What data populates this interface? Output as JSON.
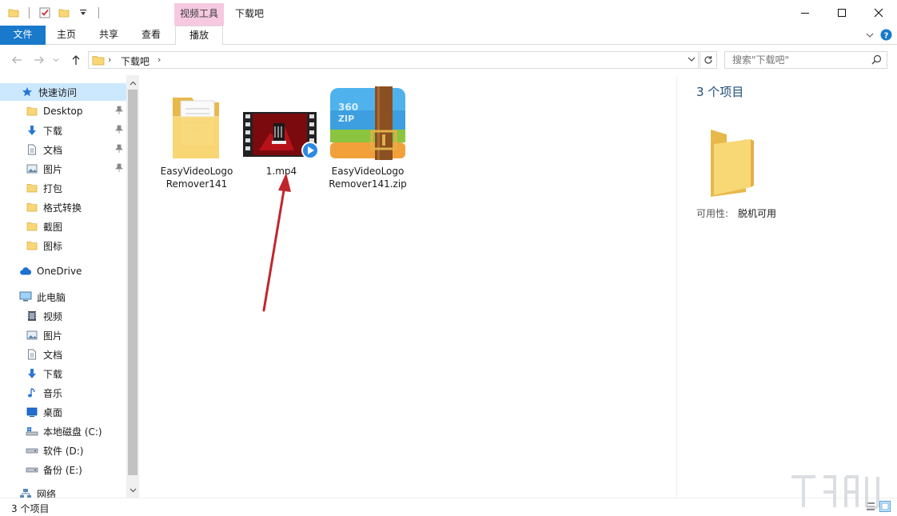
{
  "titlebar": {
    "context_group": "视频工具",
    "title": "下载吧"
  },
  "ribbon": {
    "tabs": [
      {
        "label": "文件"
      },
      {
        "label": "主页"
      },
      {
        "label": "共享"
      },
      {
        "label": "查看"
      },
      {
        "label": "播放"
      }
    ]
  },
  "address": {
    "path": "下载吧"
  },
  "search": {
    "placeholder": "搜索\"下载吧\""
  },
  "nav": {
    "quick_access": "快速访问",
    "quick_items": [
      {
        "label": "Desktop",
        "icon": "folder-icon"
      },
      {
        "label": "下载",
        "icon": "download-arrow-icon"
      },
      {
        "label": "文档",
        "icon": "document-icon"
      },
      {
        "label": "图片",
        "icon": "picture-icon"
      },
      {
        "label": "打包",
        "icon": "folder-icon"
      },
      {
        "label": "格式转换",
        "icon": "folder-icon"
      },
      {
        "label": "截图",
        "icon": "folder-icon"
      },
      {
        "label": "图标",
        "icon": "folder-icon"
      }
    ],
    "onedrive": "OneDrive",
    "this_pc": "此电脑",
    "pc_items": [
      {
        "label": "视频",
        "icon": "video-icon"
      },
      {
        "label": "图片",
        "icon": "picture-icon"
      },
      {
        "label": "文档",
        "icon": "document-icon"
      },
      {
        "label": "下载",
        "icon": "download-arrow-icon"
      },
      {
        "label": "音乐",
        "icon": "music-note-icon"
      },
      {
        "label": "桌面",
        "icon": "desktop-icon"
      },
      {
        "label": "本地磁盘 (C:)",
        "icon": "system-drive-icon"
      },
      {
        "label": "软件 (D:)",
        "icon": "drive-icon"
      },
      {
        "label": "备份 (E:)",
        "icon": "drive-icon"
      }
    ],
    "network": "网络"
  },
  "files": [
    {
      "line1": "EasyVideoLogo",
      "line2": "Remover141",
      "icon": "folder-icon"
    },
    {
      "line1": "1.mp4",
      "line2": "",
      "icon": "video-file-icon"
    },
    {
      "line1": "EasyVideoLogo",
      "line2": "Remover141.zip",
      "icon": "zip-archive-icon"
    }
  ],
  "details": {
    "count": "3 个项目",
    "availability_label": "可用性:",
    "availability_value": "脱机可用"
  },
  "status": {
    "text": "3 个项目"
  },
  "colors": {
    "accent": "#1979ca",
    "selection": "#cce8ff",
    "context_tab": "#f6c9e0",
    "folder": "#f8d775",
    "annotation_arrow": "#c0272d"
  }
}
